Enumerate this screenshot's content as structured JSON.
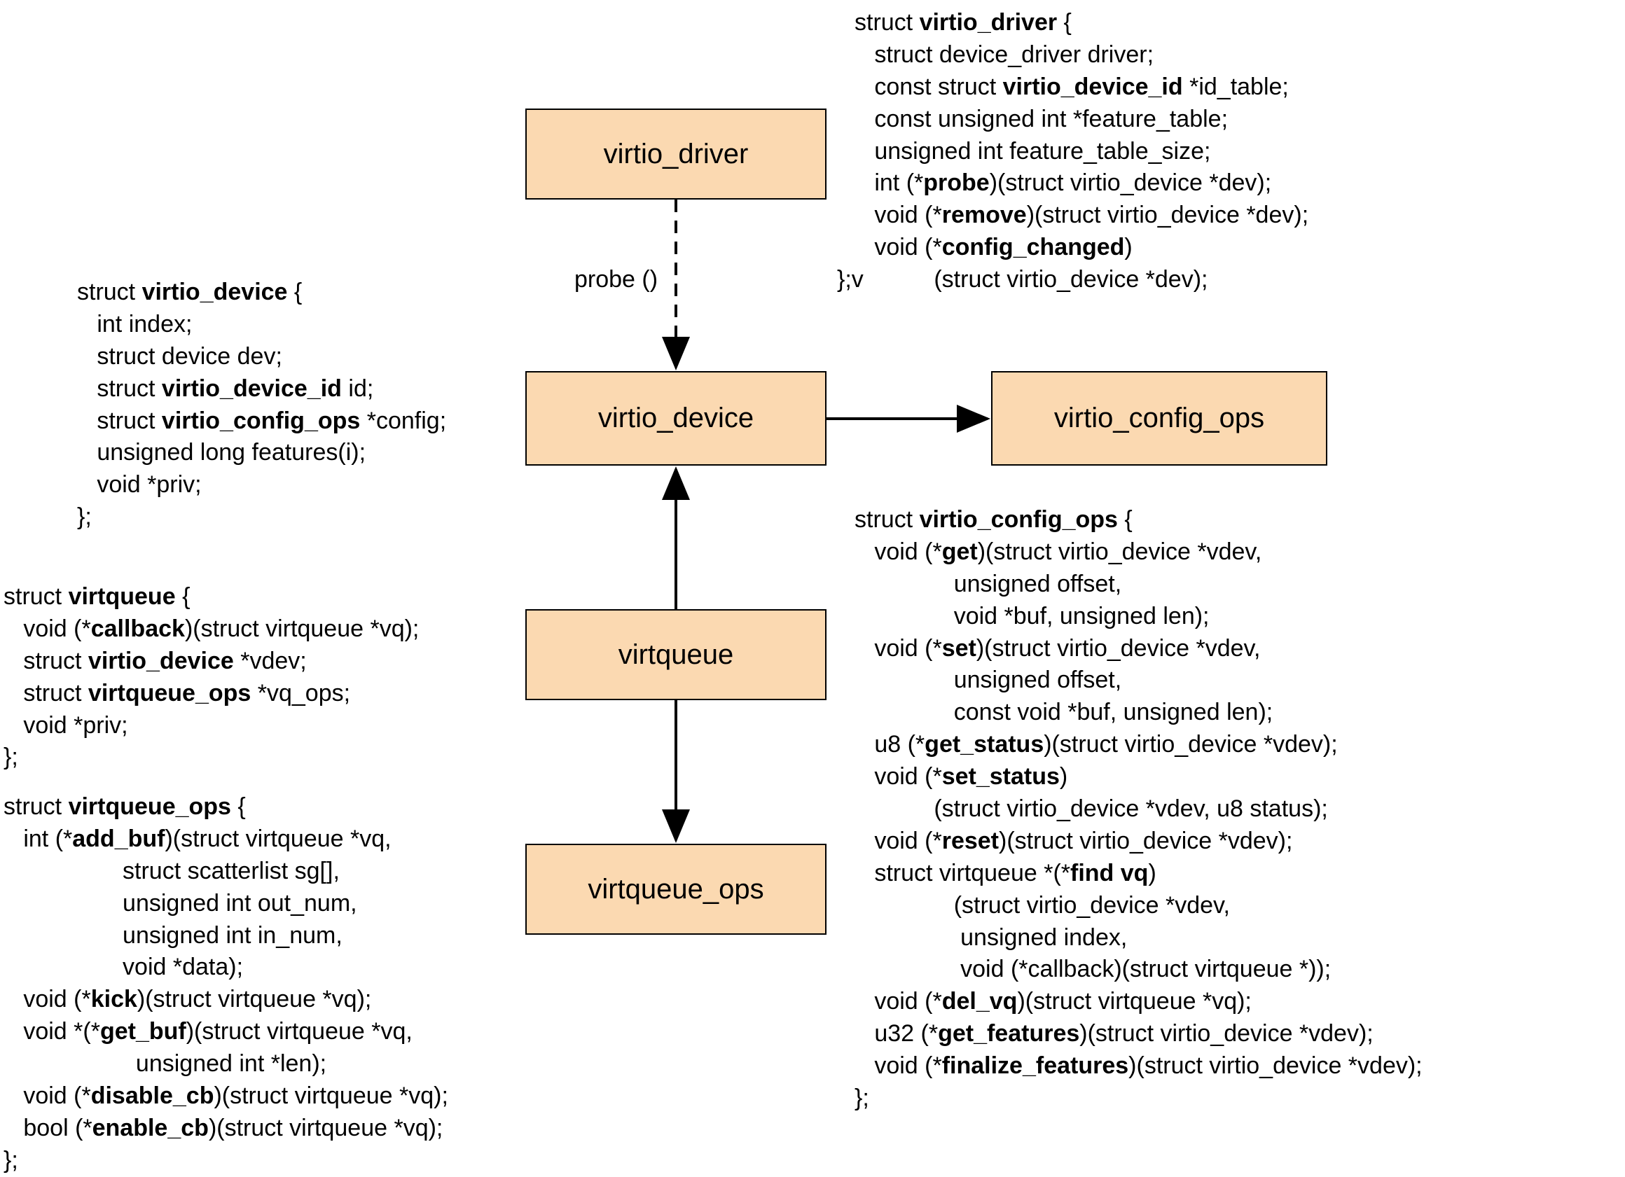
{
  "boxes": {
    "virtio_driver": "virtio_driver",
    "virtio_device": "virtio_device",
    "virtio_config_ops": "virtio_config_ops",
    "virtqueue": "virtqueue",
    "virtqueue_ops": "virtqueue_ops"
  },
  "labels": {
    "probe": "probe ()",
    "closebrace": "};v"
  },
  "code": {
    "virtio_driver": "struct <b>virtio_driver</b> {\n   struct device_driver driver;\n   const struct <b>virtio_device_id</b> *id_table;\n   const unsigned int *feature_table;\n   unsigned int feature_table_size;\n   int (*<b>probe</b>)(struct virtio_device *dev);\n   void (*<b>remove</b>)(struct virtio_device *dev);\n   void (*<b>config_changed</b>)\n            (struct virtio_device *dev);",
    "virtio_device": "struct <b>virtio_device</b> {\n   int index;\n   struct device dev;\n   struct <b>virtio_device_id</b> id;\n   struct <b>virtio_config_ops</b> *config;\n   unsigned long features(i);\n   void *priv;\n};",
    "virtqueue": "struct <b>virtqueue</b> {\n   void (*<b>callback</b>)(struct virtqueue *vq);\n   struct <b>virtio_device</b> *vdev;\n   struct <b>virtqueue_ops</b> *vq_ops;\n   void *priv;\n};",
    "virtqueue_ops": "struct <b>virtqueue_ops</b> {\n   int (*<b>add_buf</b>)(struct virtqueue *vq,\n                  struct scatterlist sg[],\n                  unsigned int out_num,\n                  unsigned int in_num,\n                  void *data);\n   void (*<b>kick</b>)(struct virtqueue *vq);\n   void *(*<b>get_buf</b>)(struct virtqueue *vq,\n                    unsigned int *len);\n   void (*<b>disable_cb</b>)(struct virtqueue *vq);\n   bool (*<b>enable_cb</b>)(struct virtqueue *vq);\n};",
    "virtio_config_ops": "struct <b>virtio_config_ops</b> {\n   void (*<b>get</b>)(struct virtio_device *vdev,\n               unsigned offset,\n               void *buf, unsigned len);\n   void (*<b>set</b>)(struct virtio_device *vdev,\n               unsigned offset,\n               const void *buf, unsigned len);\n   u8 (*<b>get_status</b>)(struct virtio_device *vdev);\n   void (*<b>set_status</b>)\n            (struct virtio_device *vdev, u8 status);\n   void (*<b>reset</b>)(struct virtio_device *vdev);\n   struct virtqueue *(*<b>find vq</b>)\n               (struct virtio_device *vdev,\n                unsigned index,\n                void (*callback)(struct virtqueue *));\n   void (*<b>del_vq</b>)(struct virtqueue *vq);\n   u32 (*<b>get_features</b>)(struct virtio_device *vdev);\n   void (*<b>finalize_features</b>)(struct virtio_device *vdev);\n};"
  }
}
